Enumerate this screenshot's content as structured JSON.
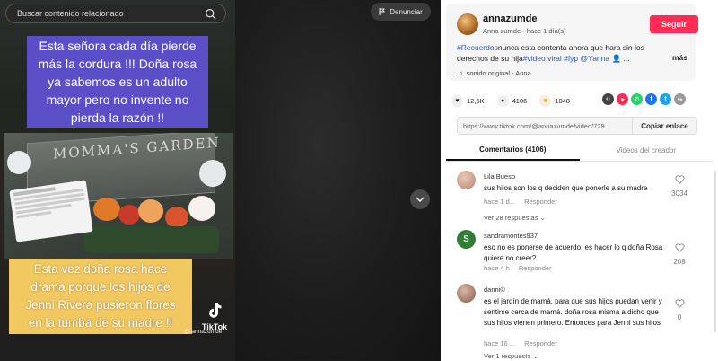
{
  "search": {
    "placeholder": "Buscar contenido relacionado"
  },
  "video": {
    "caption_top_lines": [
      "Esta señora cada día pierde",
      "más la cordura !!! Doña rosa",
      "ya sabemos es un adulto",
      "mayor pero no invente no",
      "pierda la razón !!"
    ],
    "caption_bottom_lines": [
      "Esta vez doña rosa hace",
      "drama porque los hijos de",
      "Jenni Rivera pusieron flores",
      "en la tumba de su madre !!"
    ],
    "grave_text": "MOMMA'S GARDEN",
    "tiktok_wordmark": "TikTok",
    "tiktok_handle": "@ annazumde",
    "report_label": "Denunciar"
  },
  "post": {
    "username": "annazumde",
    "subname": "Anna zumde · hace 1 día(s)",
    "follow_label": "Seguir",
    "desc_tag1": "#Recuerdos",
    "desc_text1": "nunca esta contenta ahora que hara sin los derechos de su hija",
    "desc_tag2": "#video viral",
    "desc_space": " ",
    "desc_tag3": "#fyp",
    "desc_tag4": " @Yanna",
    "desc_ellipsis": " 👤 ...",
    "more_label": "más",
    "sound": "sonido original - Anna",
    "likes": "12,5K",
    "comments_count": "4106",
    "saves": "1048",
    "link": "https://www.tiktok.com/@annazumde/video/729...",
    "copy_label": "Copiar enlace"
  },
  "tabs": {
    "comments": "Comentarios (4106)",
    "creator": "Videos del creador"
  },
  "comments": [
    {
      "name": "Lila Bueso",
      "text": "sus hijos son los q deciden que ponerle a su madre",
      "time": "hace 1 d...",
      "reply": "Responder",
      "likes": "3034",
      "thread": "Ver 28 respuestas ⌄"
    },
    {
      "name": "sandramontes937",
      "text": "eso no es ponerse de acuerdo, es hacer lo q doña Rosa quiere no creer?",
      "time": "hace 4 h",
      "reply": "Responder",
      "likes": "208",
      "avatar_letter": "S"
    },
    {
      "name": "danni©",
      "text": "es el jardín de mamá. para que sus hijos puedan venir y sentirse cerca de mamá. doña rosa misma a dicho que sus hijos vienen primero. Entonces para Jenni sus hijos",
      "time": "hace 16 ...",
      "reply": "Responder",
      "likes": "0",
      "thread": "Ver 1 respuesta ⌄"
    }
  ],
  "colors": {
    "follow": "#fe2c55",
    "caption_purple": "#5b4fc7",
    "caption_yellow": "#f2c860",
    "hashtag": "#3357a8"
  }
}
